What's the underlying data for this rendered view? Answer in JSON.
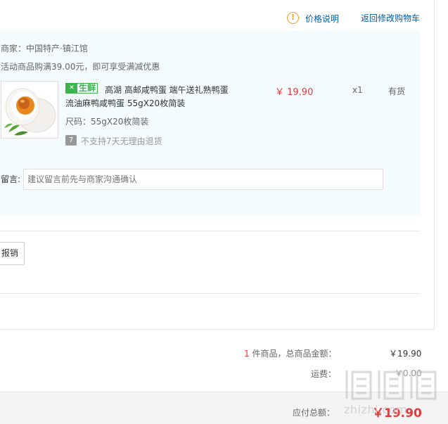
{
  "header": {
    "price_explain": "价格说明",
    "back_to_cart": "返回修改购物车",
    "info_icon_glyph": "!"
  },
  "shop": {
    "seller": "商家：中国特产·镇江馆",
    "promo": "活动商品购满39.00元，即可享受满减优惠"
  },
  "item": {
    "badge_icon": "fork-knife-icon",
    "badge_label": "生鲜",
    "title_line1": "高湖 高邮咸鸭蛋 端午送礼熟鸭蛋",
    "title_line2": "流油麻鸭咸鸭蛋 55gX20枚简装",
    "spec": "尺码：55gX20枚简装",
    "no_return_icon": "7",
    "no_return": "不支持7天无理由退货",
    "price": "￥ 19.90",
    "qty": "x1",
    "stock": "有货"
  },
  "remark": {
    "label": "留言:",
    "placeholder": "建议留言前先与商家沟通确认"
  },
  "invoice": {
    "reimburse_button": "报销"
  },
  "summary": {
    "count": "1",
    "count_text": " 件商品，总商品金额：",
    "goods_total": "￥19.90",
    "shipping_label": "运费：",
    "shipping_value": "￥0.00",
    "payable_label": "应付总额：",
    "payable_value": "￥19.90"
  },
  "watermark": {
    "text": "zhizhi.com"
  },
  "colors": {
    "link": "#005ea7",
    "price_red": "#e4393c",
    "panel_bg": "#f3fbfe",
    "fresh_green": "#3cb34b",
    "warning_orange": "#f29c33"
  }
}
